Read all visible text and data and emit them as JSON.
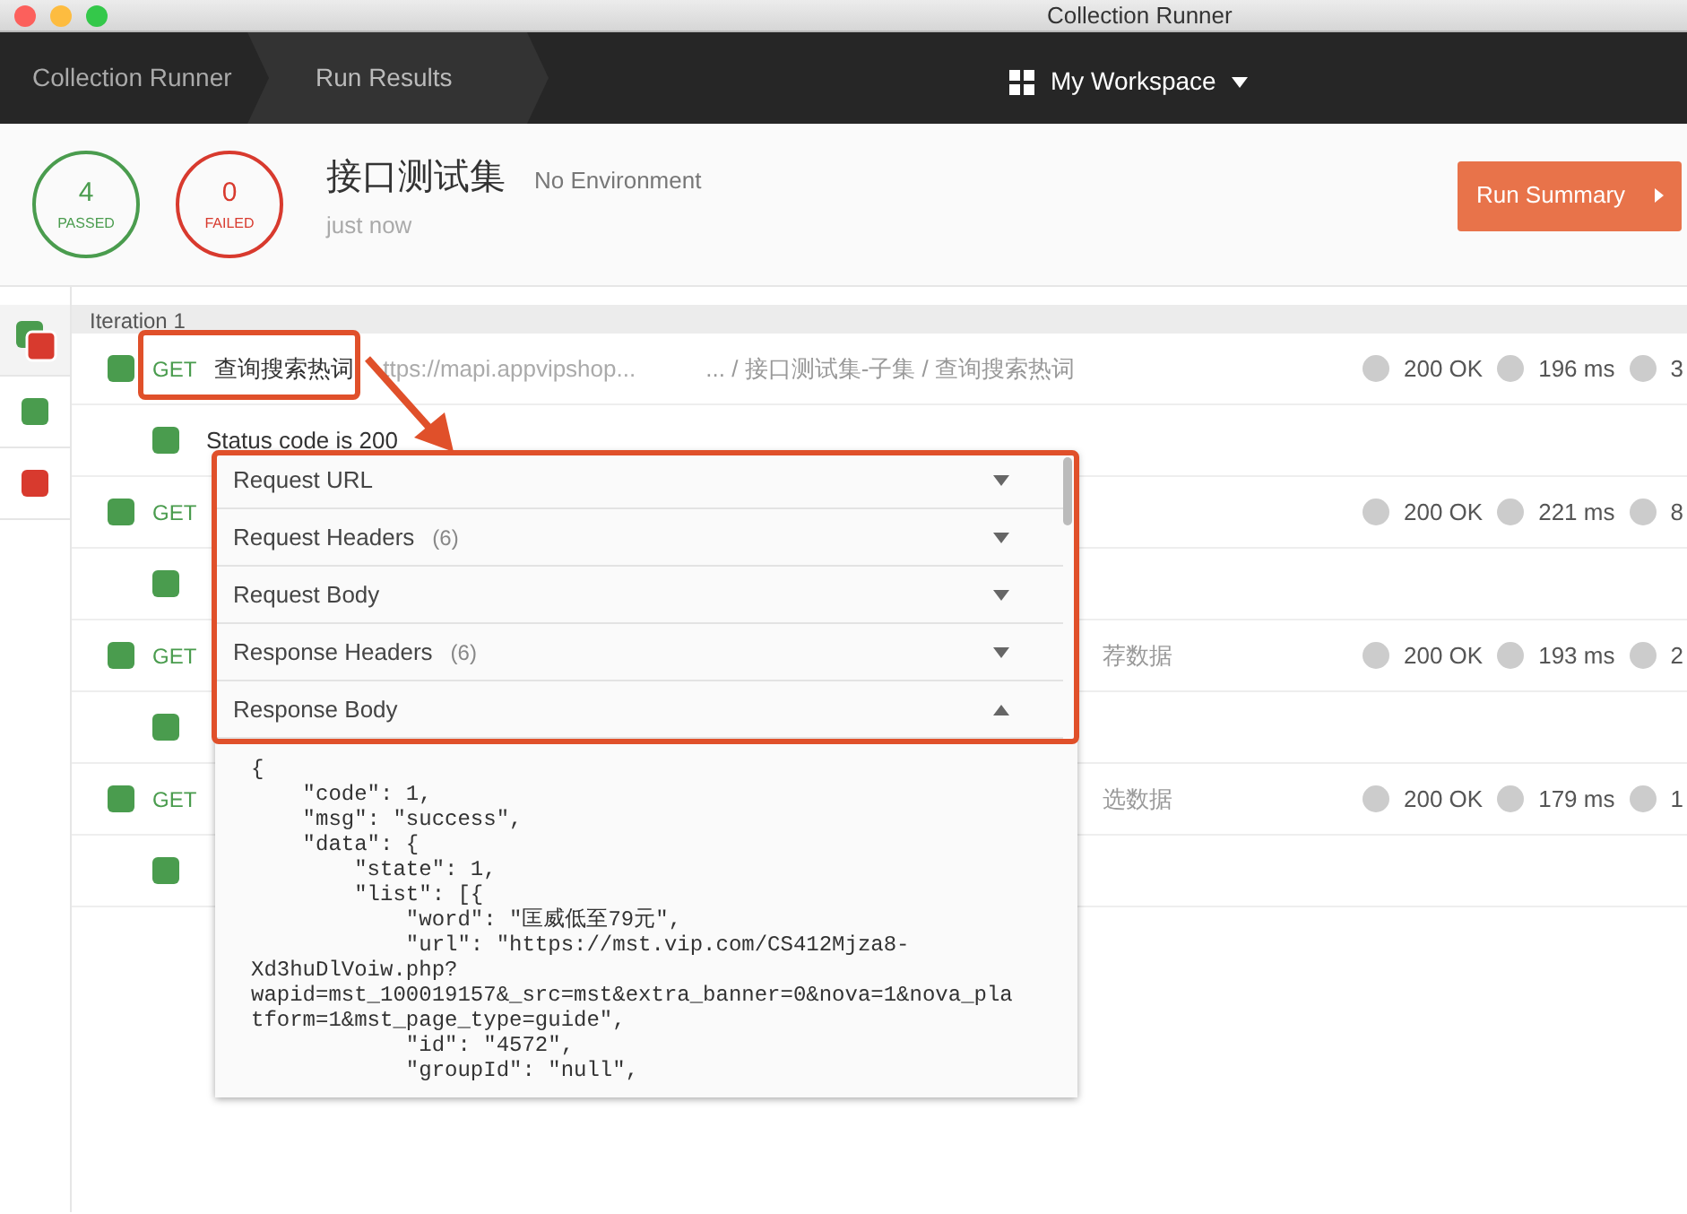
{
  "window": {
    "title": "Collection Runner"
  },
  "breadcrumbs": [
    {
      "label": "Collection Runner",
      "selected": false
    },
    {
      "label": "Run Results",
      "selected": true
    }
  ],
  "workspace": {
    "label": "My Workspace"
  },
  "summary": {
    "passed": {
      "count": "4",
      "label": "PASSED"
    },
    "failed": {
      "count": "0",
      "label": "FAILED"
    },
    "collection": "接口测试集",
    "environment": "No Environment",
    "time": "just now",
    "button": "Run Summary"
  },
  "sidebar": {
    "items": [
      {
        "kind": "mixed",
        "selected": true
      },
      {
        "kind": "passed",
        "selected": false
      },
      {
        "kind": "failed",
        "selected": false
      }
    ]
  },
  "iteration": {
    "label": "Iteration 1"
  },
  "requests": [
    {
      "passed": true,
      "method": "GET",
      "name": "查询搜索热词",
      "url": "ttps://mapi.appvipshop...",
      "path": "... / 接口测试集-子集 / 查询搜索热词",
      "status": "200 OK",
      "time": "196 ms",
      "size": "3",
      "tests": [
        {
          "passed": true,
          "name": "Status code is 200"
        }
      ]
    },
    {
      "passed": true,
      "method": "GET",
      "status": "200 OK",
      "time": "221 ms",
      "size": "8",
      "tests": [
        {
          "passed": true
        }
      ]
    },
    {
      "passed": true,
      "method": "GET",
      "path": "荐数据",
      "status": "200 OK",
      "time": "193 ms",
      "size": "2",
      "tests": [
        {
          "passed": true
        }
      ]
    },
    {
      "passed": true,
      "method": "GET",
      "path": "选数据",
      "status": "200 OK",
      "time": "179 ms",
      "size": "1",
      "tests": [
        {
          "passed": true
        }
      ]
    }
  ],
  "details": {
    "sections": [
      {
        "label": "Request URL",
        "expanded": false
      },
      {
        "label": "Request Headers",
        "count": "(6)",
        "expanded": false
      },
      {
        "label": "Request Body",
        "expanded": false
      },
      {
        "label": "Response Headers",
        "count": "(6)",
        "expanded": false
      },
      {
        "label": "Response Body",
        "expanded": true
      }
    ],
    "body_lines": [
      "{",
      "    \"code\": 1,",
      "    \"msg\": \"success\",",
      "    \"data\": {",
      "        \"state\": 1,",
      "        \"list\": [{",
      "            \"word\": \"匡威低至79元\",",
      "            \"url\": \"https://mst.vip.com/CS412Mjza8-",
      "Xd3huDlVoiw.php?",
      "wapid=mst_100019157&_src=mst&extra_banner=0&nova=1&nova_pla",
      "tform=1&mst_page_type=guide\",",
      "            \"id\": \"4572\",",
      "            \"groupId\": \"null\","
    ]
  }
}
